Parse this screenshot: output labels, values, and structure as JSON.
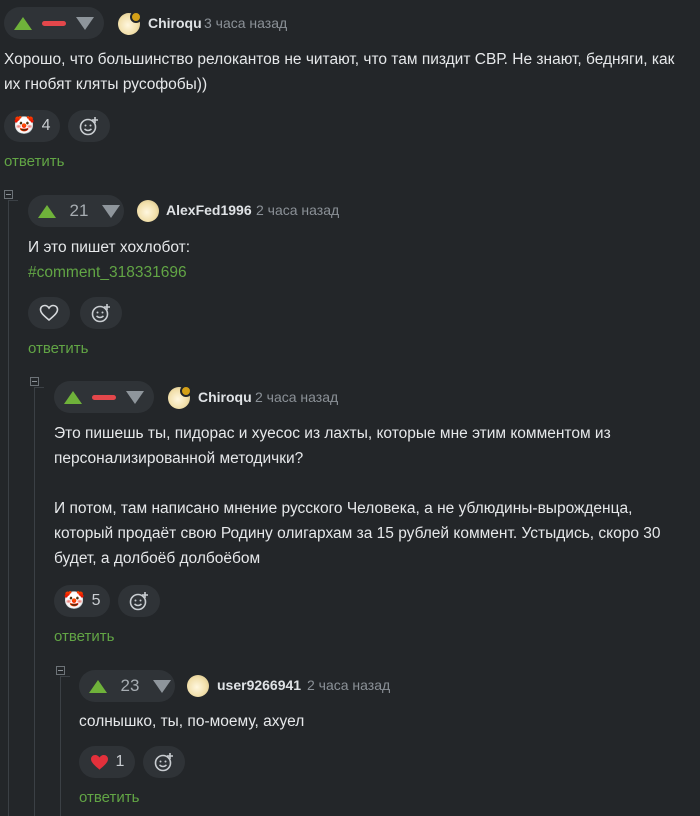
{
  "comments": [
    {
      "user": "Chiroqu",
      "time": "3 часа назад",
      "score": "",
      "text_lines": [
        "Хорошо, что большинство релокантов не читают, что там пиздит СВР. Не знают, бедняги, как",
        "их гнобят кляты русофобы))"
      ],
      "reaction": {
        "icon": "clown-emoji-icon",
        "count": "4"
      },
      "reply_label": "ответить"
    },
    {
      "user": "AlexFed1996",
      "time": "2 часа назад",
      "score": "21",
      "text_lines": [
        "И это пишет хохлобот:"
      ],
      "link": "#comment_318331696",
      "reaction": {
        "icon": "heart-outline-icon",
        "count": ""
      },
      "reply_label": "ответить"
    },
    {
      "user": "Chiroqu",
      "time": "2 часа назад",
      "score": "",
      "text_lines": [
        "Это пишешь ты, пидорас и хуесос из лахты, которые мне этим комментом из",
        "персонализированной методички?",
        "",
        "И потом, там написано мнение русского Человека, а не ублюдины-вырожденца,",
        "который продаёт свою Родину олигархам за 15 рублей коммент. Устыдись, скоро 30",
        "будет, а долбоёб долбоёбом"
      ],
      "reaction": {
        "icon": "clown-emoji-icon",
        "count": "5"
      },
      "reply_label": "ответить"
    },
    {
      "user": "user9266941",
      "time": "2 часа назад",
      "score": "23",
      "text_lines": [
        "солнышко, ты, по-моему, ахуел"
      ],
      "reaction": {
        "icon": "red-heart-icon",
        "count": "1"
      },
      "reply_label": "ответить"
    }
  ],
  "colors": {
    "background": "#232629",
    "upvote": "#6fb23a",
    "link": "#62a545",
    "minus": "#e4474b"
  }
}
